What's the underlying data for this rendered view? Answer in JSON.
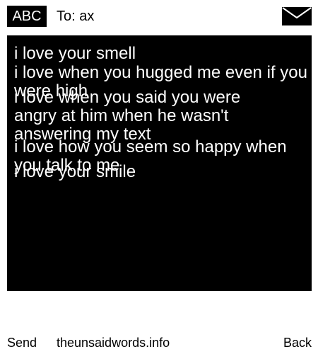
{
  "header": {
    "input_mode": "ABC",
    "recipient": "To: ax",
    "icon": "envelope-icon"
  },
  "messages": [
    "i love your smell",
    "i love when you hugged me even if you were high",
    "i love when you said you were angry at him when he wasn't answering my text",
    "i love how you seem so happy when you talk to me",
    "i love your smile"
  ],
  "softkeys": {
    "left": "Send",
    "center": "theunsaidwords.info",
    "right": "Back"
  },
  "colors": {
    "screen_background": "#000000",
    "screen_text": "#ffffff",
    "page_background": "#ffffff"
  }
}
